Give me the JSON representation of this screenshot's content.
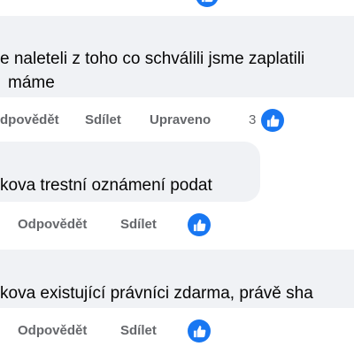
{
  "colors": {
    "bubble": "#f0f2f5",
    "action_text": "#65676b",
    "like_blue": "#1877f2"
  },
  "comments": [
    {
      "lines": [
        "e naleteli z toho co schválili jsme zaplatili",
        "máme"
      ],
      "actions": {
        "reply": "dpovědět",
        "share": "Sdílet",
        "edited": "Upraveno"
      },
      "reaction_count": "3",
      "reaction_icon": "thumbs-up-icon"
    },
    {
      "lines": [
        "kova trestní oznámení podat"
      ],
      "actions": {
        "reply": "Odpovědět",
        "share": "Sdílet"
      },
      "reaction_icon": "thumbs-up-icon"
    },
    {
      "lines": [
        "kova existující právníci zdarma, právě sha"
      ],
      "actions": {
        "reply": "Odpovědět",
        "share": "Sdílet"
      },
      "reaction_icon": "thumbs-up-icon"
    }
  ]
}
